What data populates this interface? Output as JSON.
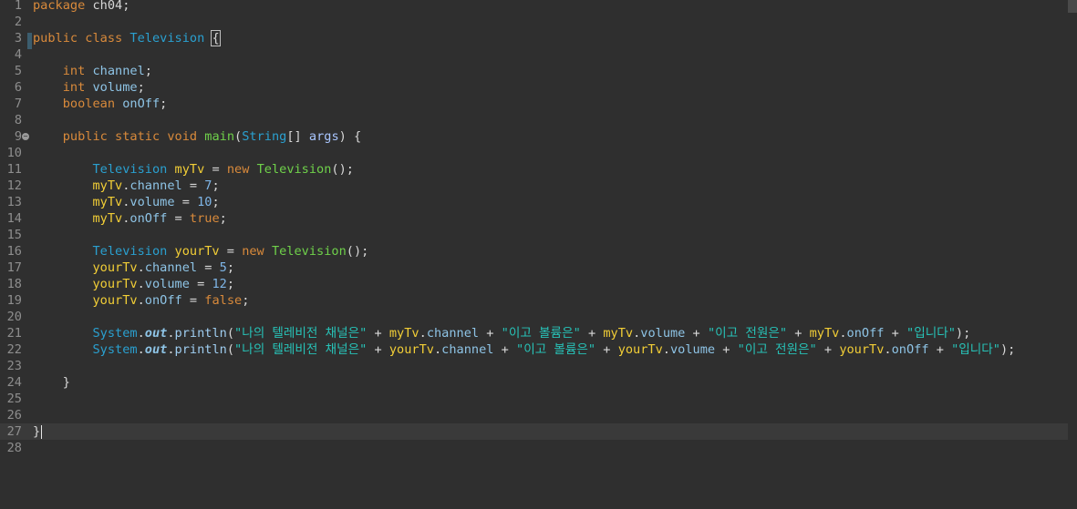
{
  "editor": {
    "current_line": 27,
    "lines": [
      {
        "n": "1",
        "tokens": [
          [
            "kw",
            "package"
          ],
          [
            "plain",
            " ch04;"
          ]
        ]
      },
      {
        "n": "2",
        "tokens": []
      },
      {
        "n": "3",
        "tokens": [
          [
            "kw",
            "public"
          ],
          [
            "plain",
            " "
          ],
          [
            "kw",
            "class"
          ],
          [
            "plain",
            " "
          ],
          [
            "type",
            "Television"
          ],
          [
            "plain",
            " "
          ],
          [
            "brace",
            "{"
          ]
        ]
      },
      {
        "n": "4",
        "tokens": []
      },
      {
        "n": "5",
        "tokens": [
          [
            "plain",
            "    "
          ],
          [
            "kw",
            "int"
          ],
          [
            "plain",
            " "
          ],
          [
            "field",
            "channel"
          ],
          [
            "plain",
            ";"
          ]
        ]
      },
      {
        "n": "6",
        "tokens": [
          [
            "plain",
            "    "
          ],
          [
            "kw",
            "int"
          ],
          [
            "plain",
            " "
          ],
          [
            "field",
            "volume"
          ],
          [
            "plain",
            ";"
          ]
        ]
      },
      {
        "n": "7",
        "tokens": [
          [
            "plain",
            "    "
          ],
          [
            "kw",
            "boolean"
          ],
          [
            "plain",
            " "
          ],
          [
            "field",
            "onOff"
          ],
          [
            "plain",
            ";"
          ]
        ]
      },
      {
        "n": "8",
        "tokens": []
      },
      {
        "n": "9",
        "fold": true,
        "tokens": [
          [
            "plain",
            "    "
          ],
          [
            "kw",
            "public"
          ],
          [
            "plain",
            " "
          ],
          [
            "kw",
            "static"
          ],
          [
            "plain",
            " "
          ],
          [
            "kw",
            "void"
          ],
          [
            "plain",
            " "
          ],
          [
            "method",
            "main"
          ],
          [
            "plain",
            "("
          ],
          [
            "type",
            "String"
          ],
          [
            "plain",
            "[] "
          ],
          [
            "param",
            "args"
          ],
          [
            "plain",
            ") {"
          ]
        ]
      },
      {
        "n": "10",
        "tokens": []
      },
      {
        "n": "11",
        "tokens": [
          [
            "plain",
            "        "
          ],
          [
            "type",
            "Television"
          ],
          [
            "plain",
            " "
          ],
          [
            "local",
            "myTv"
          ],
          [
            "plain",
            " = "
          ],
          [
            "kw",
            "new"
          ],
          [
            "plain",
            " "
          ],
          [
            "method",
            "Television"
          ],
          [
            "plain",
            "();"
          ]
        ]
      },
      {
        "n": "12",
        "tokens": [
          [
            "plain",
            "        "
          ],
          [
            "local",
            "myTv"
          ],
          [
            "plain",
            "."
          ],
          [
            "field",
            "channel"
          ],
          [
            "plain",
            " = "
          ],
          [
            "num",
            "7"
          ],
          [
            "plain",
            ";"
          ]
        ]
      },
      {
        "n": "13",
        "tokens": [
          [
            "plain",
            "        "
          ],
          [
            "local",
            "myTv"
          ],
          [
            "plain",
            "."
          ],
          [
            "field",
            "volume"
          ],
          [
            "plain",
            " = "
          ],
          [
            "num",
            "10"
          ],
          [
            "plain",
            ";"
          ]
        ]
      },
      {
        "n": "14",
        "tokens": [
          [
            "plain",
            "        "
          ],
          [
            "local",
            "myTv"
          ],
          [
            "plain",
            "."
          ],
          [
            "field",
            "onOff"
          ],
          [
            "plain",
            " = "
          ],
          [
            "kw",
            "true"
          ],
          [
            "plain",
            ";"
          ]
        ]
      },
      {
        "n": "15",
        "tokens": []
      },
      {
        "n": "16",
        "tokens": [
          [
            "plain",
            "        "
          ],
          [
            "type",
            "Television"
          ],
          [
            "plain",
            " "
          ],
          [
            "local",
            "yourTv"
          ],
          [
            "plain",
            " = "
          ],
          [
            "kw",
            "new"
          ],
          [
            "plain",
            " "
          ],
          [
            "method",
            "Television"
          ],
          [
            "plain",
            "();"
          ]
        ]
      },
      {
        "n": "17",
        "tokens": [
          [
            "plain",
            "        "
          ],
          [
            "local",
            "yourTv"
          ],
          [
            "plain",
            "."
          ],
          [
            "field",
            "channel"
          ],
          [
            "plain",
            " = "
          ],
          [
            "num",
            "5"
          ],
          [
            "plain",
            ";"
          ]
        ]
      },
      {
        "n": "18",
        "tokens": [
          [
            "plain",
            "        "
          ],
          [
            "local",
            "yourTv"
          ],
          [
            "plain",
            "."
          ],
          [
            "field",
            "volume"
          ],
          [
            "plain",
            " = "
          ],
          [
            "num",
            "12"
          ],
          [
            "plain",
            ";"
          ]
        ]
      },
      {
        "n": "19",
        "tokens": [
          [
            "plain",
            "        "
          ],
          [
            "local",
            "yourTv"
          ],
          [
            "plain",
            "."
          ],
          [
            "field",
            "onOff"
          ],
          [
            "plain",
            " = "
          ],
          [
            "kw",
            "false"
          ],
          [
            "plain",
            ";"
          ]
        ]
      },
      {
        "n": "20",
        "tokens": []
      },
      {
        "n": "21",
        "tokens": [
          [
            "plain",
            "        "
          ],
          [
            "type",
            "System"
          ],
          [
            "plain",
            "."
          ],
          [
            "static",
            "out"
          ],
          [
            "plain",
            "."
          ],
          [
            "call",
            "println"
          ],
          [
            "plain",
            "("
          ],
          [
            "str",
            "\"나의 텔레비전 채널은\""
          ],
          [
            "plain",
            " + "
          ],
          [
            "local",
            "myTv"
          ],
          [
            "plain",
            "."
          ],
          [
            "field",
            "channel"
          ],
          [
            "plain",
            " + "
          ],
          [
            "str",
            "\"이고 볼륨은\""
          ],
          [
            "plain",
            " + "
          ],
          [
            "local",
            "myTv"
          ],
          [
            "plain",
            "."
          ],
          [
            "field",
            "volume"
          ],
          [
            "plain",
            " + "
          ],
          [
            "str",
            "\"이고 전원은\""
          ],
          [
            "plain",
            " + "
          ],
          [
            "local",
            "myTv"
          ],
          [
            "plain",
            "."
          ],
          [
            "field",
            "onOff"
          ],
          [
            "plain",
            " + "
          ],
          [
            "str",
            "\"입니다\""
          ],
          [
            "plain",
            ");"
          ]
        ]
      },
      {
        "n": "22",
        "tokens": [
          [
            "plain",
            "        "
          ],
          [
            "type",
            "System"
          ],
          [
            "plain",
            "."
          ],
          [
            "static",
            "out"
          ],
          [
            "plain",
            "."
          ],
          [
            "call",
            "println"
          ],
          [
            "plain",
            "("
          ],
          [
            "str",
            "\"나의 텔레비전 채널은\""
          ],
          [
            "plain",
            " + "
          ],
          [
            "local",
            "yourTv"
          ],
          [
            "plain",
            "."
          ],
          [
            "field",
            "channel"
          ],
          [
            "plain",
            " + "
          ],
          [
            "str",
            "\"이고 볼륨은\""
          ],
          [
            "plain",
            " + "
          ],
          [
            "local",
            "yourTv"
          ],
          [
            "plain",
            "."
          ],
          [
            "field",
            "volume"
          ],
          [
            "plain",
            " + "
          ],
          [
            "str",
            "\"이고 전원은\""
          ],
          [
            "plain",
            " + "
          ],
          [
            "local",
            "yourTv"
          ],
          [
            "plain",
            "."
          ],
          [
            "field",
            "onOff"
          ],
          [
            "plain",
            " + "
          ],
          [
            "str",
            "\"입니다\""
          ],
          [
            "plain",
            ");"
          ]
        ]
      },
      {
        "n": "23",
        "tokens": []
      },
      {
        "n": "24",
        "tokens": [
          [
            "plain",
            "    }"
          ]
        ]
      },
      {
        "n": "25",
        "tokens": []
      },
      {
        "n": "26",
        "tokens": []
      },
      {
        "n": "27",
        "caret": true,
        "tokens": [
          [
            "plain",
            "}"
          ]
        ]
      },
      {
        "n": "28",
        "tokens": []
      }
    ]
  },
  "colors": {
    "background": "#2f2f2f",
    "keyword": "#d98a3b",
    "type": "#2aa0d0",
    "string": "#27c2b7",
    "local_variable": "#f2ce36",
    "method": "#6fd14a"
  }
}
